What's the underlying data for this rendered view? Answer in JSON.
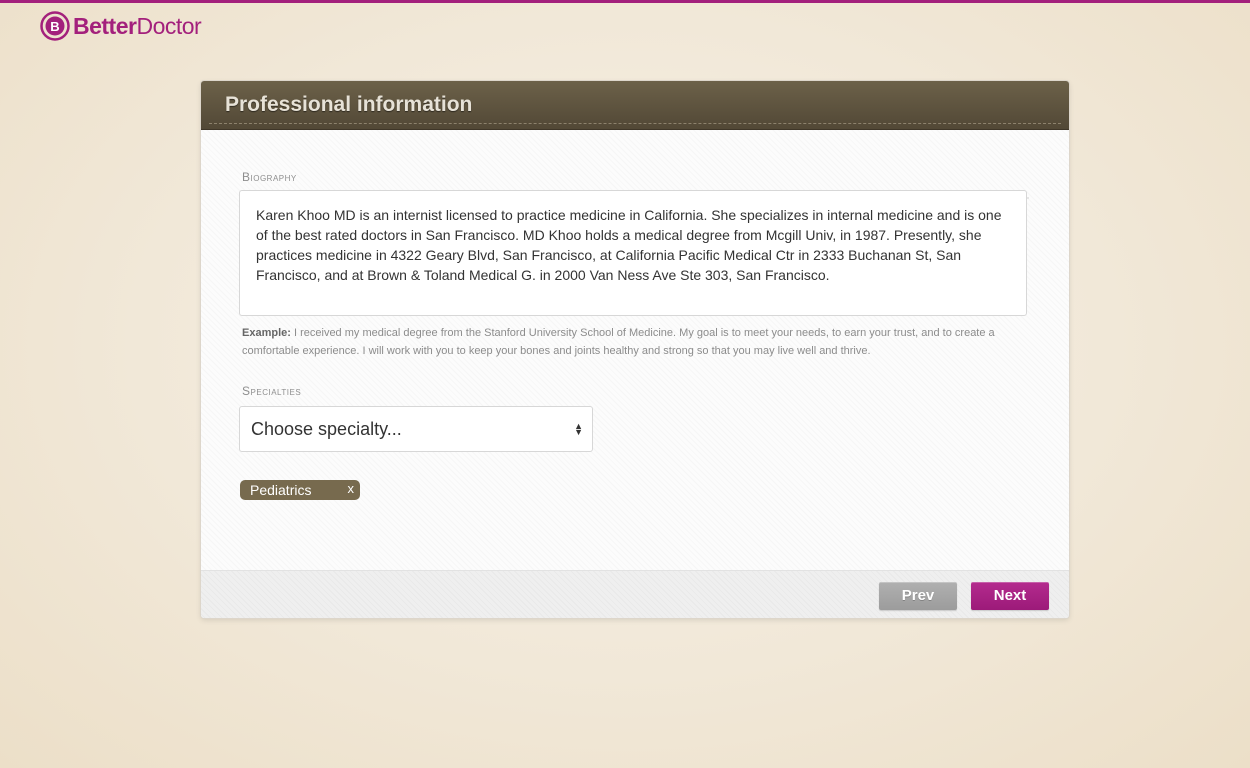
{
  "brand": {
    "name_part1": "Better",
    "name_part2": "Doctor",
    "accent_color": "#a3207c"
  },
  "page": {
    "title": "Professional information"
  },
  "progress": {
    "steps": 3,
    "current_step": 1,
    "current_fraction": 0.67
  },
  "biography": {
    "label": "Biography",
    "value": "Karen Khoo MD is an internist licensed to practice medicine in California. She specializes in internal medicine and is one of the best rated doctors in San Francisco. MD Khoo holds a medical degree from Mcgill Univ, in 1987. Presently, she practices medicine in 4322 Geary Blvd, San Francisco, at California Pacific Medical Ctr in 2333 Buchanan St, San Francisco, and at Brown & Toland Medical G. in 2000 Van Ness Ave Ste 303, San Francisco.",
    "example_label": "Example:",
    "example_text": "I received my medical degree from the Stanford University School of Medicine.  My goal is to meet your needs, to earn your trust, and to create a comfortable experience.  I will work with you to keep your bones and joints healthy and strong so that you may live well and thrive."
  },
  "specialties": {
    "label": "Specialties",
    "select_placeholder": "Choose specialty...",
    "selected": [
      {
        "label": "Pediatrics",
        "remove": "x"
      }
    ]
  },
  "footer": {
    "prev_label": "Prev",
    "next_label": "Next"
  }
}
